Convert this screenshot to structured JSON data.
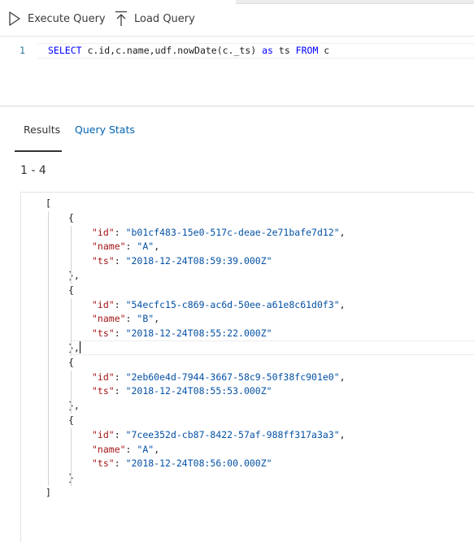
{
  "toolbar": {
    "execute_label": "Execute Query",
    "load_label": "Load Query"
  },
  "editor": {
    "line_number": "1",
    "tokens": {
      "select_kw": "SELECT",
      "projection": " c.id,c.name,udf.nowDate(c._ts) ",
      "as_kw": "as",
      "alias": " ts ",
      "from_kw": "FROM",
      "source": " c"
    }
  },
  "tabs": {
    "results_label": "Results",
    "stats_label": "Query Stats"
  },
  "result_count": "1 - 4",
  "results": {
    "open_bracket": "[",
    "close_bracket": "]",
    "documents": [
      {
        "id": "b01cf483-15e0-517c-deae-2e71bafe7d12",
        "name": "A",
        "ts": "2018-12-24T08:59:39.000Z"
      },
      {
        "id": "54ecfc15-c869-ac6d-50ee-a61e8c61d0f3",
        "name": "B",
        "ts": "2018-12-24T08:55:22.000Z"
      },
      {
        "id": "2eb60e4d-7944-3667-58c9-50f38fc901e0",
        "ts": "2018-12-24T08:55:53.000Z"
      },
      {
        "id": "7cee352d-cb87-8422-57af-988ff317a3a3",
        "name": "A",
        "ts": "2018-12-24T08:56:00.000Z"
      }
    ]
  },
  "colors": {
    "keyword": "#0000ff",
    "json_key": "#a31515",
    "json_string": "#0451a5",
    "link": "#0063b1",
    "line_number": "#237893"
  },
  "icons": {
    "execute": "play-outline-icon",
    "load": "upload-arrow-icon"
  }
}
